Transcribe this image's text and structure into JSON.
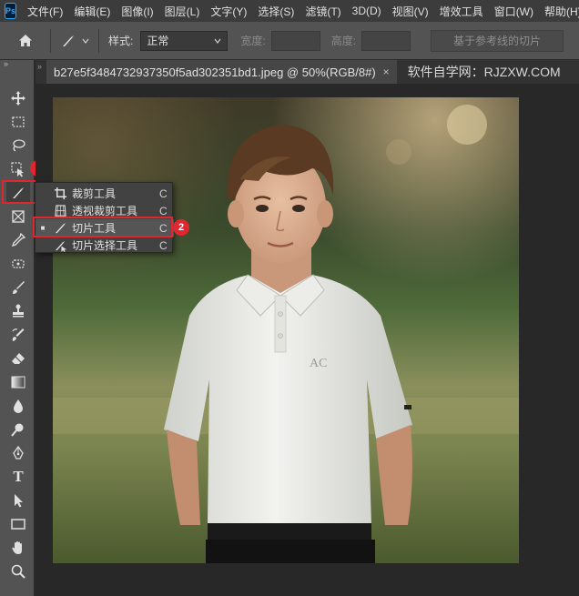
{
  "app": {
    "logo_text": "Ps"
  },
  "menu": {
    "items": [
      "文件(F)",
      "编辑(E)",
      "图像(I)",
      "图层(L)",
      "文字(Y)",
      "选择(S)",
      "滤镜(T)",
      "3D(D)",
      "视图(V)",
      "增效工具",
      "窗口(W)",
      "帮助(H)"
    ]
  },
  "options": {
    "style_label": "样式:",
    "style_value": "正常",
    "width_label": "宽度:",
    "height_label": "高度:",
    "guides_button": "基于参考线的切片"
  },
  "tabs": {
    "scroll_glyph": "»",
    "active_title": "b27e5f3484732937350f5ad302351bd1.jpeg @ 50%(RGB/8#)",
    "close_glyph": "×",
    "watermark": "软件自学网：RJZXW.COM"
  },
  "toolbar": {
    "grip_glyph": "»",
    "tools": [
      {
        "name": "move-tool",
        "icon": "move-icon"
      },
      {
        "name": "marquee-tool",
        "icon": "marquee-icon"
      },
      {
        "name": "lasso-tool",
        "icon": "lasso-icon"
      },
      {
        "name": "object-select-tool",
        "icon": "object-select-icon"
      },
      {
        "name": "slice-tool",
        "icon": "knife-icon"
      },
      {
        "name": "frame-tool",
        "icon": "frame-icon"
      },
      {
        "name": "eyedropper-tool",
        "icon": "eyedropper-icon"
      },
      {
        "name": "healing-tool",
        "icon": "healing-icon"
      },
      {
        "name": "brush-tool",
        "icon": "brush-icon"
      },
      {
        "name": "stamp-tool",
        "icon": "stamp-icon"
      },
      {
        "name": "history-brush-tool",
        "icon": "history-brush-icon"
      },
      {
        "name": "eraser-tool",
        "icon": "eraser-icon"
      },
      {
        "name": "gradient-tool",
        "icon": "gradient-icon"
      },
      {
        "name": "blur-tool",
        "icon": "drop-icon"
      },
      {
        "name": "dodge-tool",
        "icon": "dodge-icon"
      },
      {
        "name": "pen-tool",
        "icon": "pen-icon"
      },
      {
        "name": "type-tool",
        "icon": "type-icon"
      },
      {
        "name": "path-select-tool",
        "icon": "arrow-icon"
      },
      {
        "name": "rectangle-tool",
        "icon": "rectangle-icon"
      },
      {
        "name": "hand-tool",
        "icon": "hand-icon"
      },
      {
        "name": "zoom-tool",
        "icon": "zoom-icon"
      }
    ],
    "type_glyph": "T"
  },
  "flyout": {
    "items": [
      {
        "label": "裁剪工具",
        "key": "C",
        "icon": "crop-icon",
        "active": false
      },
      {
        "label": "透视裁剪工具",
        "key": "C",
        "icon": "perspective-crop-icon",
        "active": false
      },
      {
        "label": "切片工具",
        "key": "C",
        "icon": "slice-icon",
        "active": true
      },
      {
        "label": "切片选择工具",
        "key": "C",
        "icon": "slice-select-icon",
        "active": false
      }
    ],
    "active_mark": "■"
  },
  "annotations": {
    "badge1": "1",
    "badge2": "2"
  },
  "colors": {
    "accent": "#e0262f",
    "menubar": "#3c3c3c",
    "panel": "#535353",
    "canvas": "#282828"
  }
}
